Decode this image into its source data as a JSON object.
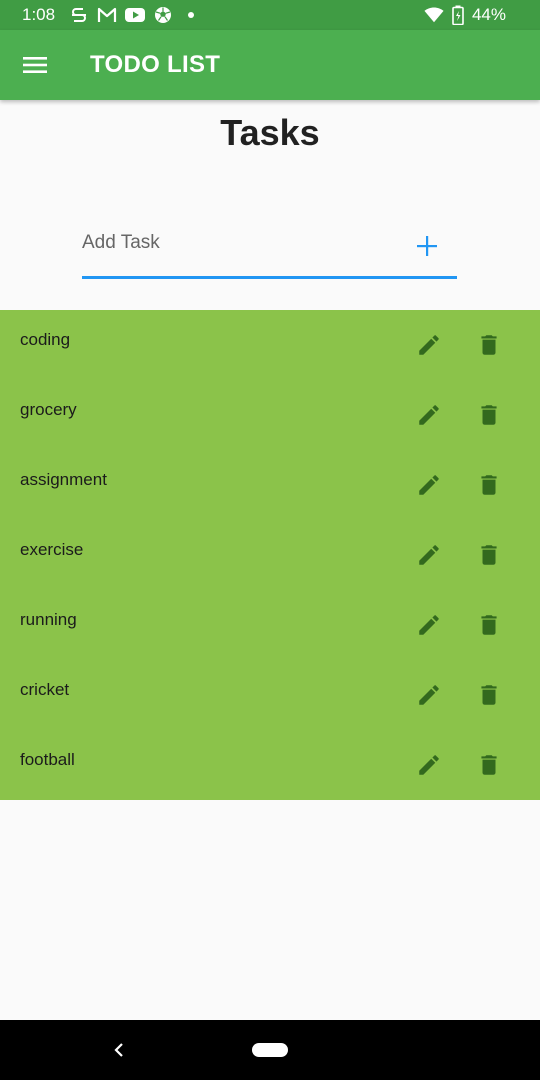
{
  "status_bar": {
    "time": "1:08",
    "battery": "44%",
    "icons": [
      "s-logo-icon",
      "gmail-icon",
      "youtube-icon",
      "soccer-ball-icon",
      "dot-icon",
      "wifi-icon",
      "battery-icon"
    ]
  },
  "app_bar": {
    "title": "TODO LIST",
    "menu_icon": "hamburger-menu-icon"
  },
  "page": {
    "heading": "Tasks"
  },
  "add_task": {
    "placeholder": "Add Task",
    "value": "",
    "add_icon": "plus-icon"
  },
  "tasks": [
    {
      "label": "coding"
    },
    {
      "label": "grocery"
    },
    {
      "label": "assignment"
    },
    {
      "label": "exercise"
    },
    {
      "label": "running"
    },
    {
      "label": "cricket"
    },
    {
      "label": "football"
    }
  ],
  "colors": {
    "status_bar": "#409c44",
    "app_bar": "#4caf50",
    "list_background": "#8bc34a",
    "action_icons": "#33691e",
    "accent": "#2196f3",
    "nav_bar": "#000000"
  }
}
